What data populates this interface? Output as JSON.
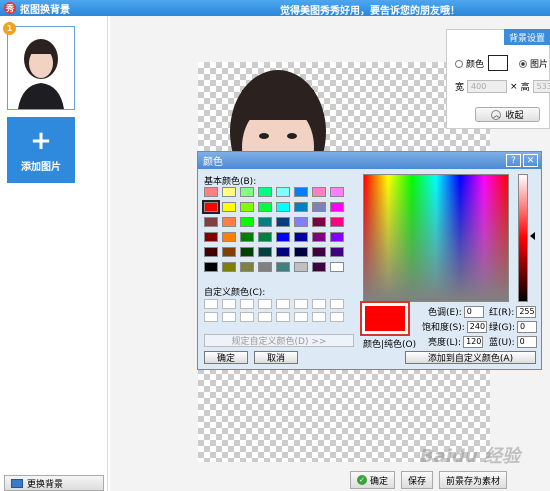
{
  "app": {
    "title": "抠图换背景",
    "slogan": "觉得美图秀秀好用，要告诉您的朋友哦！",
    "logo": "秀"
  },
  "left_panel": {
    "badge": "1",
    "add_photo": "添加图片",
    "plus": "+",
    "change_bg": "更换背景"
  },
  "bg_settings": {
    "tab": "背景设置",
    "color_option": "颜色",
    "picture_option": "图片",
    "width_label": "宽",
    "width_value": "400",
    "times": "×",
    "height_label": "高",
    "height_value": "533",
    "collapse": "收起",
    "collapse_icon": "chevron-up-icon"
  },
  "color_dialog": {
    "title": "颜色",
    "help": "?",
    "close": "✕",
    "basic_colors_label": "基本颜色(B):",
    "custom_colors_label": "自定义颜色(C):",
    "define_custom": "规定自定义颜色(D) >>",
    "ok": "确定",
    "cancel": "取消",
    "color_solid_label": "颜色|纯色(O)",
    "hue_label": "色调(E):",
    "hue": "0",
    "sat_label": "饱和度(S):",
    "sat": "240",
    "lum_label": "亮度(L):",
    "lum": "120",
    "red_label": "红(R):",
    "red": "255",
    "green_label": "绿(G):",
    "green": "0",
    "blue_label": "蓝(U):",
    "blue": "0",
    "add_custom": "添加到自定义颜色(A)",
    "selected_color": "#ff0000",
    "basic_colors": [
      "#ff8080",
      "#ffff80",
      "#80ff80",
      "#00ff80",
      "#80ffff",
      "#0080ff",
      "#ff80c0",
      "#ff80ff",
      "#ff0000",
      "#ffff00",
      "#80ff00",
      "#00ff40",
      "#00ffff",
      "#0080c0",
      "#8080c0",
      "#ff00ff",
      "#804040",
      "#ff8040",
      "#00ff00",
      "#008080",
      "#004080",
      "#8080ff",
      "#800040",
      "#ff0080",
      "#800000",
      "#ff8000",
      "#008000",
      "#008040",
      "#0000ff",
      "#0000a0",
      "#800080",
      "#8000ff",
      "#400000",
      "#804000",
      "#004000",
      "#004040",
      "#000080",
      "#000040",
      "#400040",
      "#400080",
      "#000000",
      "#808000",
      "#808040",
      "#808080",
      "#408080",
      "#c0c0c0",
      "#400040",
      "#ffffff"
    ]
  },
  "bottom": {
    "ok": "确定",
    "save": "保存",
    "save_material": "前景存为素材"
  },
  "watermark": "Baidu 经验"
}
